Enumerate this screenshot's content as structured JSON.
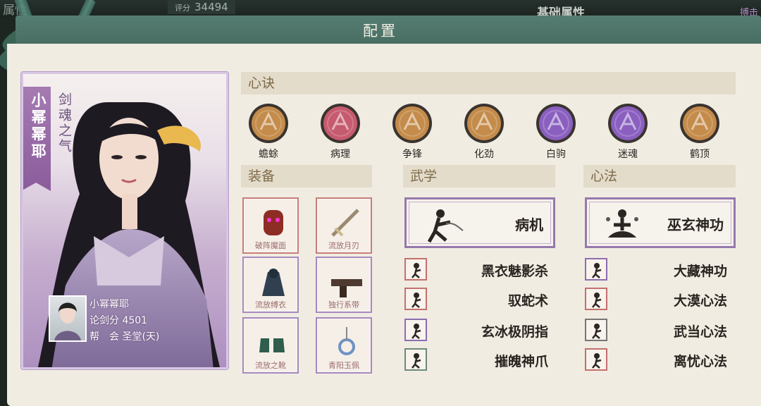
{
  "background": {
    "left_tab": "属性",
    "score_label": "评分",
    "score_value": "34494",
    "right_title": "基础属性",
    "right_tag": "搏击"
  },
  "panel": {
    "title": "配置"
  },
  "character": {
    "name": "小幂幂耶",
    "title": "剑魂之气",
    "info": {
      "name": "小幂幂耶",
      "score_text": "论剑分 4501",
      "guild_text": "帮　会 圣堂(天)"
    }
  },
  "sections": {
    "xinjue": "心诀",
    "equipment": "装备",
    "martial": "武学",
    "mental": "心法"
  },
  "xinjue_skills": [
    {
      "name": "蟾蜍",
      "color": "#c48b4a"
    },
    {
      "name": "病理",
      "color": "#c65a6e"
    },
    {
      "name": "争锋",
      "color": "#c48b4a"
    },
    {
      "name": "化劲",
      "color": "#c48b4a"
    },
    {
      "name": "白驹",
      "color": "#8a5fc0"
    },
    {
      "name": "迷魂",
      "color": "#8a5fc0"
    },
    {
      "name": "鹤顶",
      "color": "#c48b4a"
    }
  ],
  "equipment": [
    {
      "name": "破阵魔面",
      "icon": "mask-icon"
    },
    {
      "name": "流放月刃",
      "icon": "blade-icon"
    },
    {
      "name": "流放缚衣",
      "icon": "cloak-icon"
    },
    {
      "name": "独行系带",
      "icon": "belt-icon"
    },
    {
      "name": "流放之靴",
      "icon": "boots-icon"
    },
    {
      "name": "青阳玉佩",
      "icon": "pendant-icon"
    }
  ],
  "martial": {
    "main": "病机",
    "list": [
      "黑衣魅影杀",
      "驭蛇术",
      "玄冰极阴指",
      "摧魄神爪"
    ]
  },
  "mental": {
    "main": "巫玄神功",
    "list": [
      "大藏神功",
      "大漠心法",
      "武当心法",
      "离忧心法"
    ]
  }
}
